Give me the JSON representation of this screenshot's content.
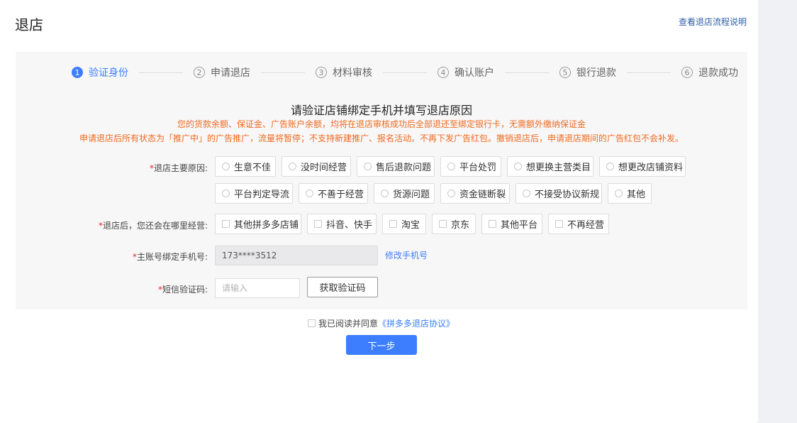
{
  "header": {
    "title": "退店",
    "help_link": "查看退店流程说明"
  },
  "steps": [
    {
      "num": "1",
      "label": "验证身份",
      "active": true
    },
    {
      "num": "2",
      "label": "申请退店",
      "active": false
    },
    {
      "num": "3",
      "label": "材料审核",
      "active": false
    },
    {
      "num": "4",
      "label": "确认账户",
      "active": false
    },
    {
      "num": "5",
      "label": "银行退款",
      "active": false
    },
    {
      "num": "6",
      "label": "退款成功",
      "active": false
    }
  ],
  "form": {
    "title": "请验证店铺绑定手机并填写退店原因",
    "notice_line1": "您的货款余额、保证金、广告账户余额，均将在退店审核成功后全部退还至绑定银行卡，无需额外缴纳保证金",
    "notice_line2": "申请退店后所有状态为「推广中」的广告推广，流量将暂停；不支持新建推广、报名活动。不再下发广告红包。撤销退店后，申请退店期间的广告红包不会补发。",
    "reason_label": "退店主要原因:",
    "reasons": [
      "生意不佳",
      "没时间经营",
      "售后退款问题",
      "平台处罚",
      "想更换主营类目",
      "想更改店铺资料",
      "平台判定导流",
      "不善于经营",
      "货源问题",
      "资金链断裂",
      "不接受协议新规",
      "其他"
    ],
    "future_label": "退店后，您还会在哪里经营:",
    "future_options": [
      "其他拼多多店铺",
      "抖音、快手",
      "淘宝",
      "京东",
      "其他平台",
      "不再经营"
    ],
    "phone_label": "主账号绑定手机号:",
    "phone_value": "173****3512",
    "modify_phone": "修改手机号",
    "sms_label": "短信验证码:",
    "sms_placeholder": "请输入",
    "get_code": "获取验证码",
    "required_mark": "*"
  },
  "footer": {
    "agree_text": "我已阅读并同意",
    "protocol_link": "《拼多多退店协议》",
    "next_button": "下一步"
  },
  "colors": {
    "accent": "#3c7eff",
    "warning": "#f06a1e",
    "required": "#ee2222"
  }
}
